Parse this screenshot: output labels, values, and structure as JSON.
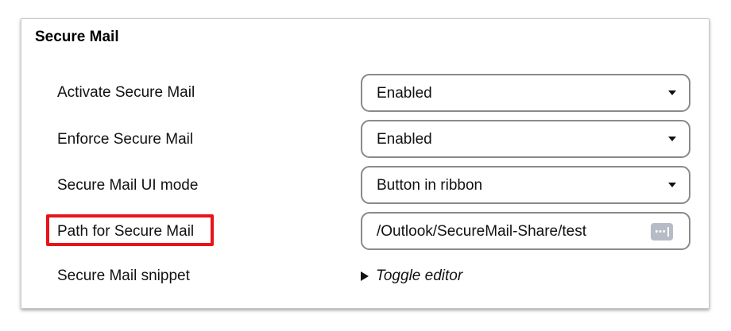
{
  "section": {
    "title": "Secure Mail"
  },
  "rows": [
    {
      "label": "Activate Secure Mail",
      "value": "Enabled",
      "control": "select"
    },
    {
      "label": "Enforce Secure Mail",
      "value": "Enabled",
      "control": "select"
    },
    {
      "label": "Secure Mail UI mode",
      "value": "Button in ribbon",
      "control": "select"
    },
    {
      "label": "Path for Secure Mail",
      "value": "/Outlook/SecureMail-Share/test",
      "control": "text",
      "highlighted": true
    },
    {
      "label": "Secure Mail snippet",
      "value": "Toggle editor",
      "control": "toggle"
    }
  ],
  "icons": {
    "select_caret": "chevron-down-icon",
    "path_picker": "more-icon",
    "toggle": "triangle-right-icon"
  },
  "colors": {
    "highlight": "#e8141b",
    "control_border": "#8a8a8a",
    "picker_button": "#b5bcc6"
  }
}
